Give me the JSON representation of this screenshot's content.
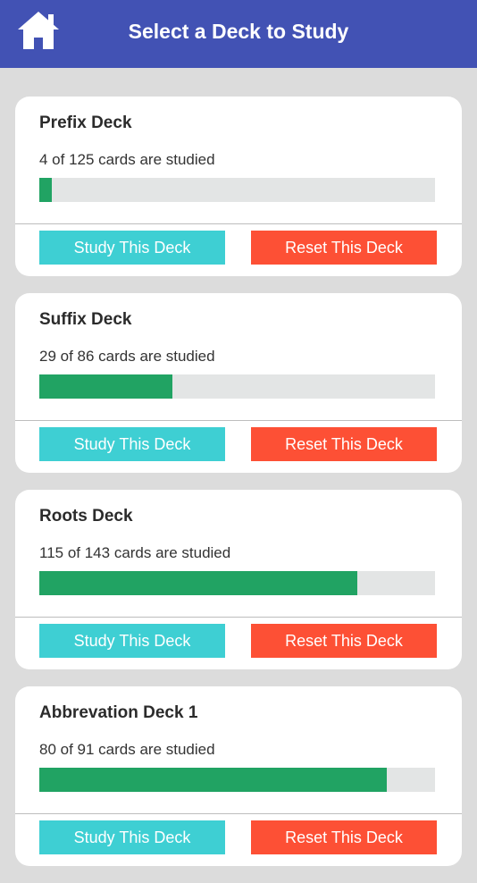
{
  "header": {
    "title": "Select a Deck to Study",
    "home_icon": "home-icon",
    "background": "#4252b4"
  },
  "decks": [
    {
      "title": "Prefix Deck",
      "progress_text": "4 of 125 cards are studied",
      "studied": 4,
      "total": 125,
      "study_label": "Study This Deck",
      "reset_label": "Reset This Deck"
    },
    {
      "title": "Suffix Deck",
      "progress_text": "29 of 86 cards are studied",
      "studied": 29,
      "total": 86,
      "study_label": "Study This Deck",
      "reset_label": "Reset This Deck"
    },
    {
      "title": "Roots Deck",
      "progress_text": "115 of 143 cards are studied",
      "studied": 115,
      "total": 143,
      "study_label": "Study This Deck",
      "reset_label": "Reset This Deck"
    },
    {
      "title": "Abbrevation Deck 1",
      "progress_text": "80 of 91 cards are studied",
      "studied": 80,
      "total": 91,
      "study_label": "Study This Deck",
      "reset_label": "Reset This Deck"
    }
  ],
  "colors": {
    "progress_fill": "#21a363",
    "progress_track": "#e3e5e5",
    "study_button": "#3ecfd3",
    "reset_button": "#fd5035",
    "page_background": "#dcdcdc"
  }
}
